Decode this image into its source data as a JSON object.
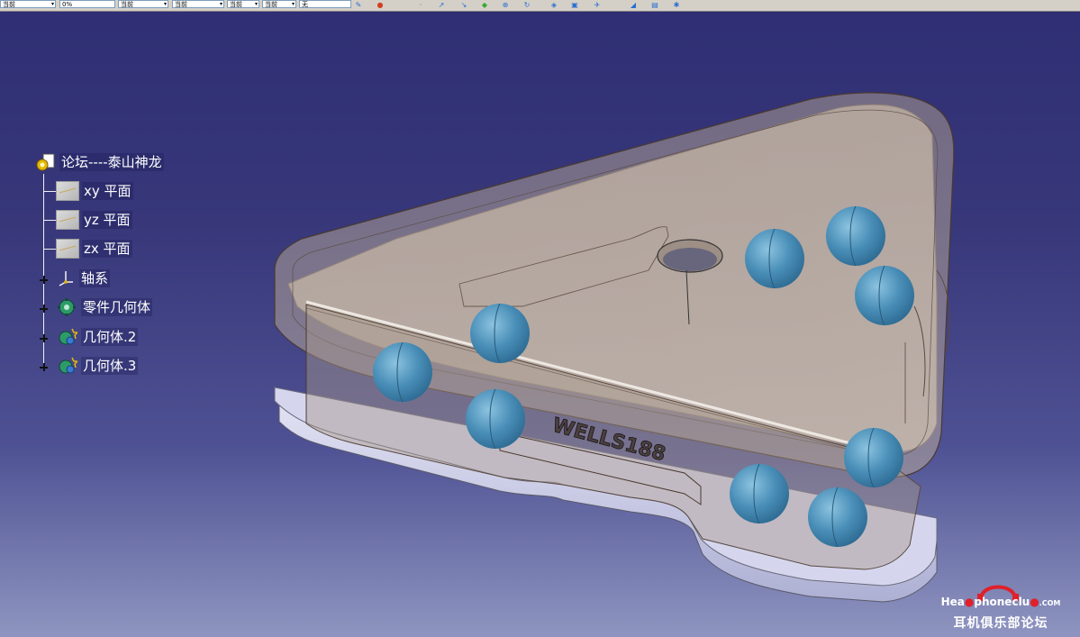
{
  "toolbar": {
    "combos": [
      "当前",
      "0%",
      "当前",
      "当前",
      "当前",
      "当前",
      "无"
    ]
  },
  "tree": {
    "root": "论坛----泰山神龙",
    "items": [
      {
        "label": "xy 平面",
        "icon": "plane-icon"
      },
      {
        "label": "yz 平面",
        "icon": "plane-icon"
      },
      {
        "label": "zx 平面",
        "icon": "plane-icon"
      },
      {
        "label": "轴系",
        "icon": "axis-system-icon"
      },
      {
        "label": "零件几何体",
        "icon": "part-body-icon"
      },
      {
        "label": "几何体.2",
        "icon": "body-icon"
      },
      {
        "label": "几何体.3",
        "icon": "body-icon"
      }
    ]
  },
  "model": {
    "engraving": "WELLS188"
  },
  "watermark": {
    "brand_pre": "Hea",
    "brand_post": "phoneclu",
    "brand_suffix": ".COM",
    "cn": "耳机俱乐部论坛"
  },
  "colors": {
    "background_top": "#2f2e74",
    "background_bottom": "#8f95c0",
    "shell": "#b8a89a",
    "sphere": "#4a8fb8",
    "base": "#c9cbe6",
    "watermark_red": "#e0202a"
  }
}
